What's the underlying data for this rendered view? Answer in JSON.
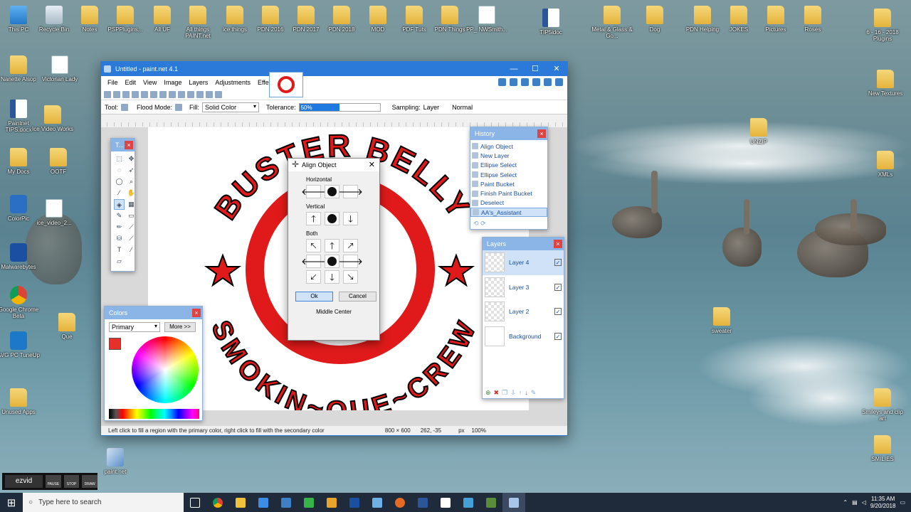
{
  "desktop_icons": [
    {
      "label": "This PC",
      "kind": "pc"
    },
    {
      "label": "Recycle Bin",
      "kind": "bin"
    },
    {
      "label": "Notes",
      "kind": "folder"
    },
    {
      "label": "PSPPlugins...",
      "kind": "folder"
    },
    {
      "label": "All UF",
      "kind": "folder"
    },
    {
      "label": "All things PAINT.net",
      "kind": "folder"
    },
    {
      "label": "ice things",
      "kind": "folder"
    },
    {
      "label": "PDN 2016",
      "kind": "folder"
    },
    {
      "label": "PDN 2017",
      "kind": "folder"
    },
    {
      "label": "PDN 2018",
      "kind": "folder"
    },
    {
      "label": "MOD",
      "kind": "folder"
    },
    {
      "label": "PDF Tuts",
      "kind": "folder"
    },
    {
      "label": "PDN Things",
      "kind": "folder"
    },
    {
      "label": "PP_ NWSmith...",
      "kind": "doc"
    },
    {
      "label": "TIP5idoc",
      "kind": "word"
    },
    {
      "label": "Metal & Glass & Go...",
      "kind": "folder"
    },
    {
      "label": "Dog",
      "kind": "folder"
    },
    {
      "label": "PDN Helping",
      "kind": "folder"
    },
    {
      "label": "JOKES",
      "kind": "folder"
    },
    {
      "label": "Pictures",
      "kind": "folder"
    },
    {
      "label": "Roses",
      "kind": "folder"
    },
    {
      "label": "6 - 16 - 2018 Plugins",
      "kind": "folder"
    },
    {
      "label": "Nanette Alsop",
      "kind": "folder"
    },
    {
      "label": "Victorian Lady",
      "kind": "doc"
    },
    {
      "label": "New Textures",
      "kind": "folder"
    },
    {
      "label": "Paintnet TIPS.docx",
      "kind": "word"
    },
    {
      "label": "Ice Video Works",
      "kind": "folder"
    },
    {
      "label": "UNZIP",
      "kind": "folder"
    },
    {
      "label": "My Docs",
      "kind": "folder"
    },
    {
      "label": "OOTF",
      "kind": "folder"
    },
    {
      "label": "XMLs",
      "kind": "folder"
    },
    {
      "label": "ColorPic",
      "kind": "app-blue"
    },
    {
      "label": "ice_video_2...",
      "kind": "doc"
    },
    {
      "label": "Malwarebytes",
      "kind": "mb"
    },
    {
      "label": "Google Chrome Beta",
      "kind": "chrome"
    },
    {
      "label": "Que",
      "kind": "folder"
    },
    {
      "label": "sweater",
      "kind": "folder"
    },
    {
      "label": "AVG PC TuneUp",
      "kind": "avg"
    },
    {
      "label": "Unused Apps",
      "kind": "folder"
    },
    {
      "label": "Smileys and clip art",
      "kind": "folder"
    },
    {
      "label": "SMILIES",
      "kind": "folder"
    },
    {
      "label": "paint.net",
      "kind": "pdn"
    }
  ],
  "pdn": {
    "title": "Untitled - paint.net 4.1",
    "window_controls": [
      "—",
      "☐",
      "✕"
    ],
    "menus": [
      "File",
      "Edit",
      "View",
      "Image",
      "Layers",
      "Adjustments",
      "Effects"
    ],
    "tool_label": "Tool:",
    "flood_mode_label": "Flood Mode:",
    "fill_label": "Fill:",
    "fill_value": "Solid Color",
    "tolerance_label": "Tolerance:",
    "tolerance_value": "50%",
    "tolerance_fraction": 0.5,
    "sampling_label": "Sampling:",
    "sampling_value": "Layer",
    "blend_value": "Normal",
    "status_hint": "Left click to fill a region with the primary color, right click to fill with the secondary color",
    "image_size": "800 × 600",
    "cursor_pos": "262, -35",
    "unit": "px",
    "zoom": "100%"
  },
  "logo": {
    "top_text": "BUSTER BELLY",
    "bottom_text": "SMOKIN~QUE~CREW",
    "accent": "#e01a1a"
  },
  "tools_panel": {
    "title": "T...",
    "close": "×"
  },
  "colors_panel": {
    "title": "Colors",
    "close": "×",
    "mode": "Primary",
    "more": "More >>",
    "primary_color": "#e8302a"
  },
  "history_panel": {
    "title": "History",
    "close": "×",
    "items": [
      "Align Object",
      "New Layer",
      "Ellipse Select",
      "Ellipse Select",
      "Paint Bucket",
      "Finish Paint Bucket",
      "Deselect",
      "AA's_Assistant"
    ]
  },
  "layers_panel": {
    "title": "Layers",
    "close": "×",
    "layers": [
      {
        "name": "Layer 4",
        "visible": "✓"
      },
      {
        "name": "Layer 3",
        "visible": "✓"
      },
      {
        "name": "Layer 2",
        "visible": "✓"
      },
      {
        "name": "Background",
        "visible": "✓"
      }
    ]
  },
  "align_dialog": {
    "title": "Align Object",
    "close": "✕",
    "horizontal_label": "Horizontal",
    "vertical_label": "Vertical",
    "both_label": "Both",
    "ok": "Ok",
    "cancel": "Cancel",
    "status": "Middle Center"
  },
  "taskbar": {
    "search_placeholder": "Type here to search",
    "time": "11:35 AM",
    "date": "9/20/2018"
  },
  "ezvid": {
    "logo": "ezvid",
    "sub": "RECORDER",
    "pause": "PAUSE",
    "stop": "STOP",
    "draw": "DRAW"
  }
}
